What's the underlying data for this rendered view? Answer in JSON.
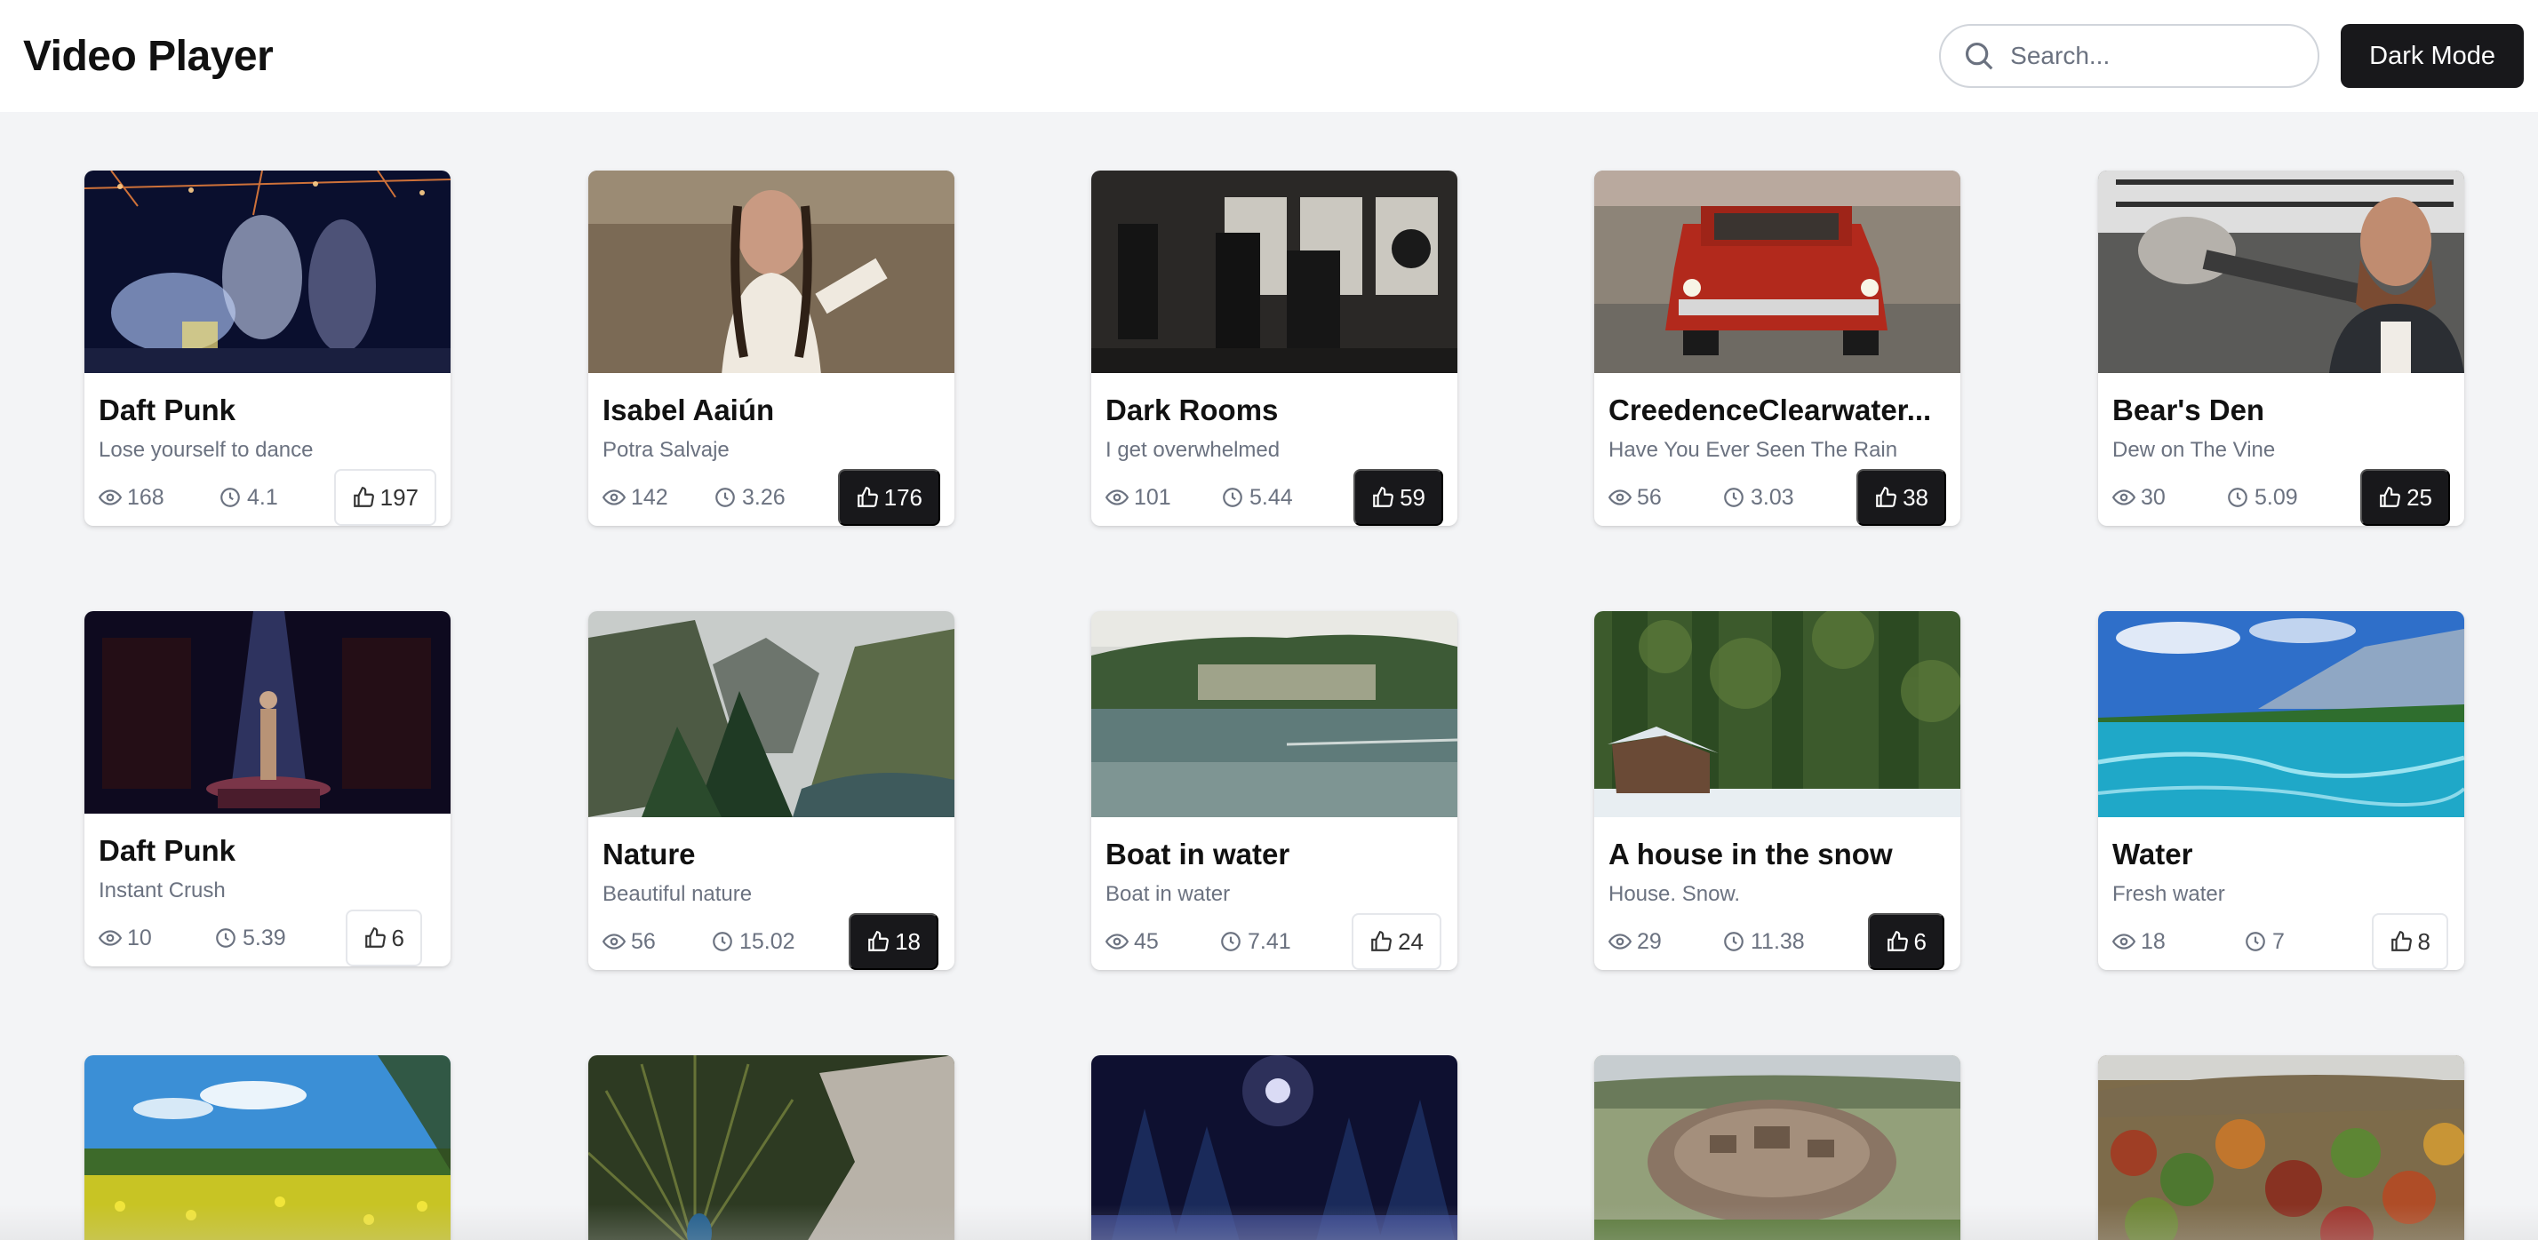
{
  "app": {
    "title": "Video Player"
  },
  "search": {
    "placeholder": "Search...",
    "icon": "search-icon"
  },
  "toolbar": {
    "dark_mode_label": "Dark Mode"
  },
  "colors": {
    "accent_dark": "#18181b",
    "background": "#f3f4f6",
    "muted_text": "#6b7280"
  },
  "videos": [
    {
      "title": "Daft Punk",
      "subtitle": "Lose yourself to dance",
      "views": "168",
      "duration": "4.1",
      "likes": "197",
      "liked": false
    },
    {
      "title": "Isabel Aaiún",
      "subtitle": "Potra Salvaje",
      "views": "142",
      "duration": "3.26",
      "likes": "176",
      "liked": true
    },
    {
      "title": "Dark Rooms",
      "subtitle": "I get overwhelmed",
      "views": "101",
      "duration": "5.44",
      "likes": "59",
      "liked": true
    },
    {
      "title": "CreedenceClearwater...",
      "subtitle": "Have You Ever Seen The Rain",
      "views": "56",
      "duration": "3.03",
      "likes": "38",
      "liked": true
    },
    {
      "title": "Bear's Den",
      "subtitle": "Dew on The Vine",
      "views": "30",
      "duration": "5.09",
      "likes": "25",
      "liked": true
    },
    {
      "title": "Daft Punk",
      "subtitle": "Instant Crush",
      "views": "10",
      "duration": "5.39",
      "likes": "6",
      "liked": false
    },
    {
      "title": "Nature",
      "subtitle": "Beautiful nature",
      "views": "56",
      "duration": "15.02",
      "likes": "18",
      "liked": true
    },
    {
      "title": "Boat in water",
      "subtitle": "Boat in water",
      "views": "45",
      "duration": "7.41",
      "likes": "24",
      "liked": false
    },
    {
      "title": "A house in the snow",
      "subtitle": "House. Snow.",
      "views": "29",
      "duration": "11.38",
      "likes": "6",
      "liked": true
    },
    {
      "title": "Water",
      "subtitle": "Fresh water",
      "views": "18",
      "duration": "7",
      "likes": "8",
      "liked": false
    }
  ]
}
